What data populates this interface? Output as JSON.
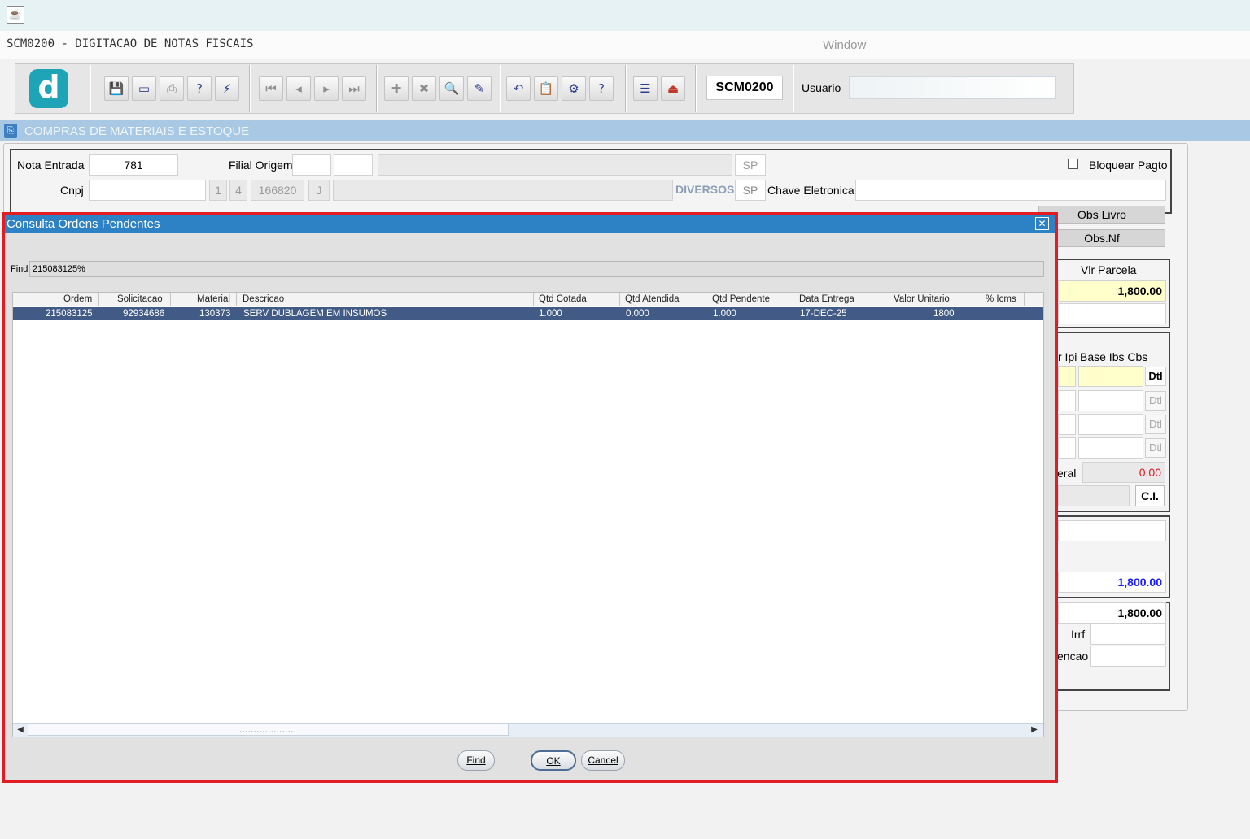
{
  "window": {
    "form_title": "SCM0200 - DIGITACAO DE NOTAS FISCAIS",
    "menu_window": "Window"
  },
  "toolbar": {
    "logo_letter": "d",
    "form_code": "SCM0200",
    "usuario_label": "Usuario",
    "buttons": [
      "save-icon",
      "window-icon",
      "print-icon",
      "query-icon",
      "execute-icon",
      "first-record-icon",
      "previous-record-icon",
      "next-record-icon",
      "last-record-icon",
      "insert-record-icon",
      "delete-record-icon",
      "search-record-icon",
      "edit-record-icon",
      "undo-icon",
      "clipboard-icon",
      "tools-icon",
      "help-icon",
      "menu-icon",
      "exit-icon"
    ]
  },
  "module": {
    "title": "COMPRAS DE MATERIAIS E ESTOQUE"
  },
  "header": {
    "nota_entrada_label": "Nota Entrada",
    "nota_entrada_value": "781",
    "filial_origem_label": "Filial Origem",
    "uf_value": "SP",
    "bloquear_label": "Bloquear Pagto",
    "cnpj_label": "Cnpj",
    "cnpj_1": "1",
    "cnpj_2": "4",
    "cnpj_3": "166820",
    "cnpj_4": "J",
    "diversos": "DIVERSOS",
    "uf2_value": "SP",
    "chave_label": "Chave Eletronica",
    "obs_livro": "Obs Livro",
    "obs_nf": "Obs.Nf"
  },
  "right_panel": {
    "vlr_parcela_label": "Vlr Parcela",
    "vlr_parcela_value": "1,800.00",
    "ipi_label": "r Ipi",
    "base_ibs_label": "Base Ibs Cbs",
    "dtl_label": "Dtl",
    "geral_label": "eral",
    "geral_value": "0.00",
    "ci_button": "C.I.",
    "total_blue": "1,800.00",
    "total_black": "1,800.00",
    "irrf_label": "Irrf",
    "retencao_label": "encao"
  },
  "modal": {
    "title": "Consulta Ordens Pendentes",
    "find_label": "Find",
    "find_value": "215083125%",
    "columns": [
      "Ordem",
      "Solicitacao",
      "Material",
      "Descricao",
      "Qtd Cotada",
      "Qtd Atendida",
      "Qtd Pendente",
      "Data Entrega",
      "Valor Unitario",
      "% Icms"
    ],
    "rows": [
      [
        "215083125",
        "92934686",
        "130373",
        "SERV DUBLAGEM EM INSUMOS",
        "1.000",
        "0.000",
        "1.000",
        "17-DEC-25",
        "1800",
        ""
      ]
    ],
    "scroll_grip": "::::::::::::::::::::",
    "find_button": "Find",
    "ok_button": "OK",
    "cancel_button": "Cancel"
  },
  "colors": {
    "modal_title_bg": "#2d82c6",
    "selected_row": "#415a86",
    "modal_border": "#e31b23",
    "module_bar": "#a8c8e4"
  }
}
